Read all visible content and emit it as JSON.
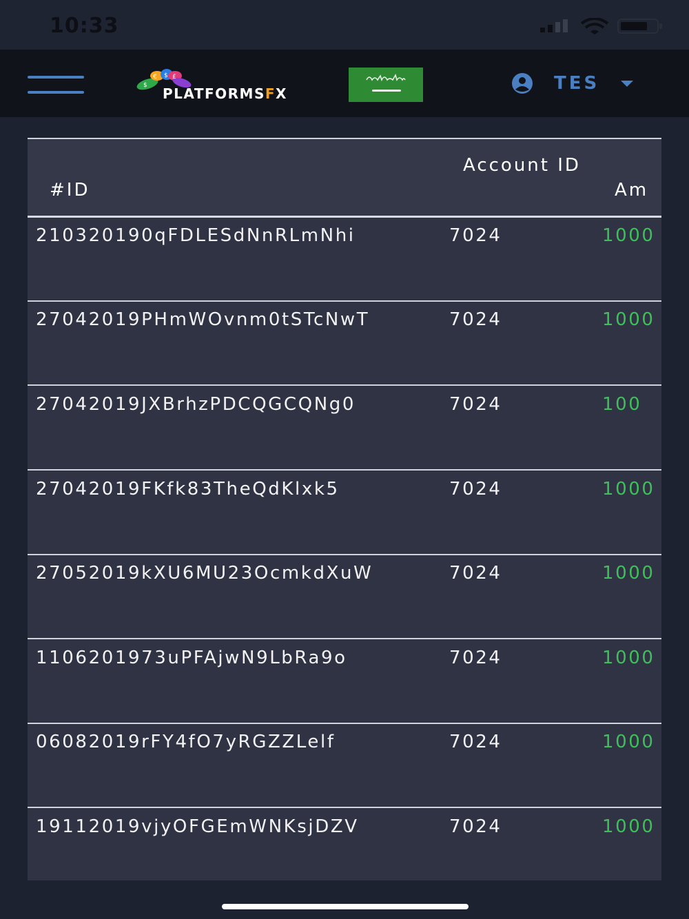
{
  "status_bar": {
    "time": "10:33"
  },
  "navbar": {
    "logo": {
      "text_main": "PLATFORMS",
      "text_f": "F",
      "text_x": "X"
    },
    "user": {
      "name": "TES"
    },
    "colors": {
      "accent": "#4a7fc1",
      "flag": "#2f8a34"
    }
  },
  "table": {
    "headers": {
      "id": "#ID",
      "account_id": "Account ID",
      "amount": "Am"
    },
    "rows": [
      {
        "id": "210320190qFDLESdNnRLmNhi",
        "account_id": "7024",
        "amount": "1000"
      },
      {
        "id": "27042019PHmWOvnm0tSTcNwT",
        "account_id": "7024",
        "amount": "1000"
      },
      {
        "id": "27042019JXBrhzPDCQGCQNg0",
        "account_id": "7024",
        "amount": "100"
      },
      {
        "id": "27042019FKfk83TheQdKlxk5",
        "account_id": "7024",
        "amount": "1000"
      },
      {
        "id": "27052019kXU6MU23OcmkdXuW",
        "account_id": "7024",
        "amount": "1000"
      },
      {
        "id": "1106201973uPFAjwN9LbRa9o",
        "account_id": "7024",
        "amount": "1000"
      },
      {
        "id": "06082019rFY4fO7yRGZZLelf",
        "account_id": "7024",
        "amount": "1000"
      },
      {
        "id": "19112019vjyOFGEmWNKsjDZV",
        "account_id": "7024",
        "amount": "1000"
      }
    ],
    "colors": {
      "amount": "#3fbf5a"
    }
  }
}
